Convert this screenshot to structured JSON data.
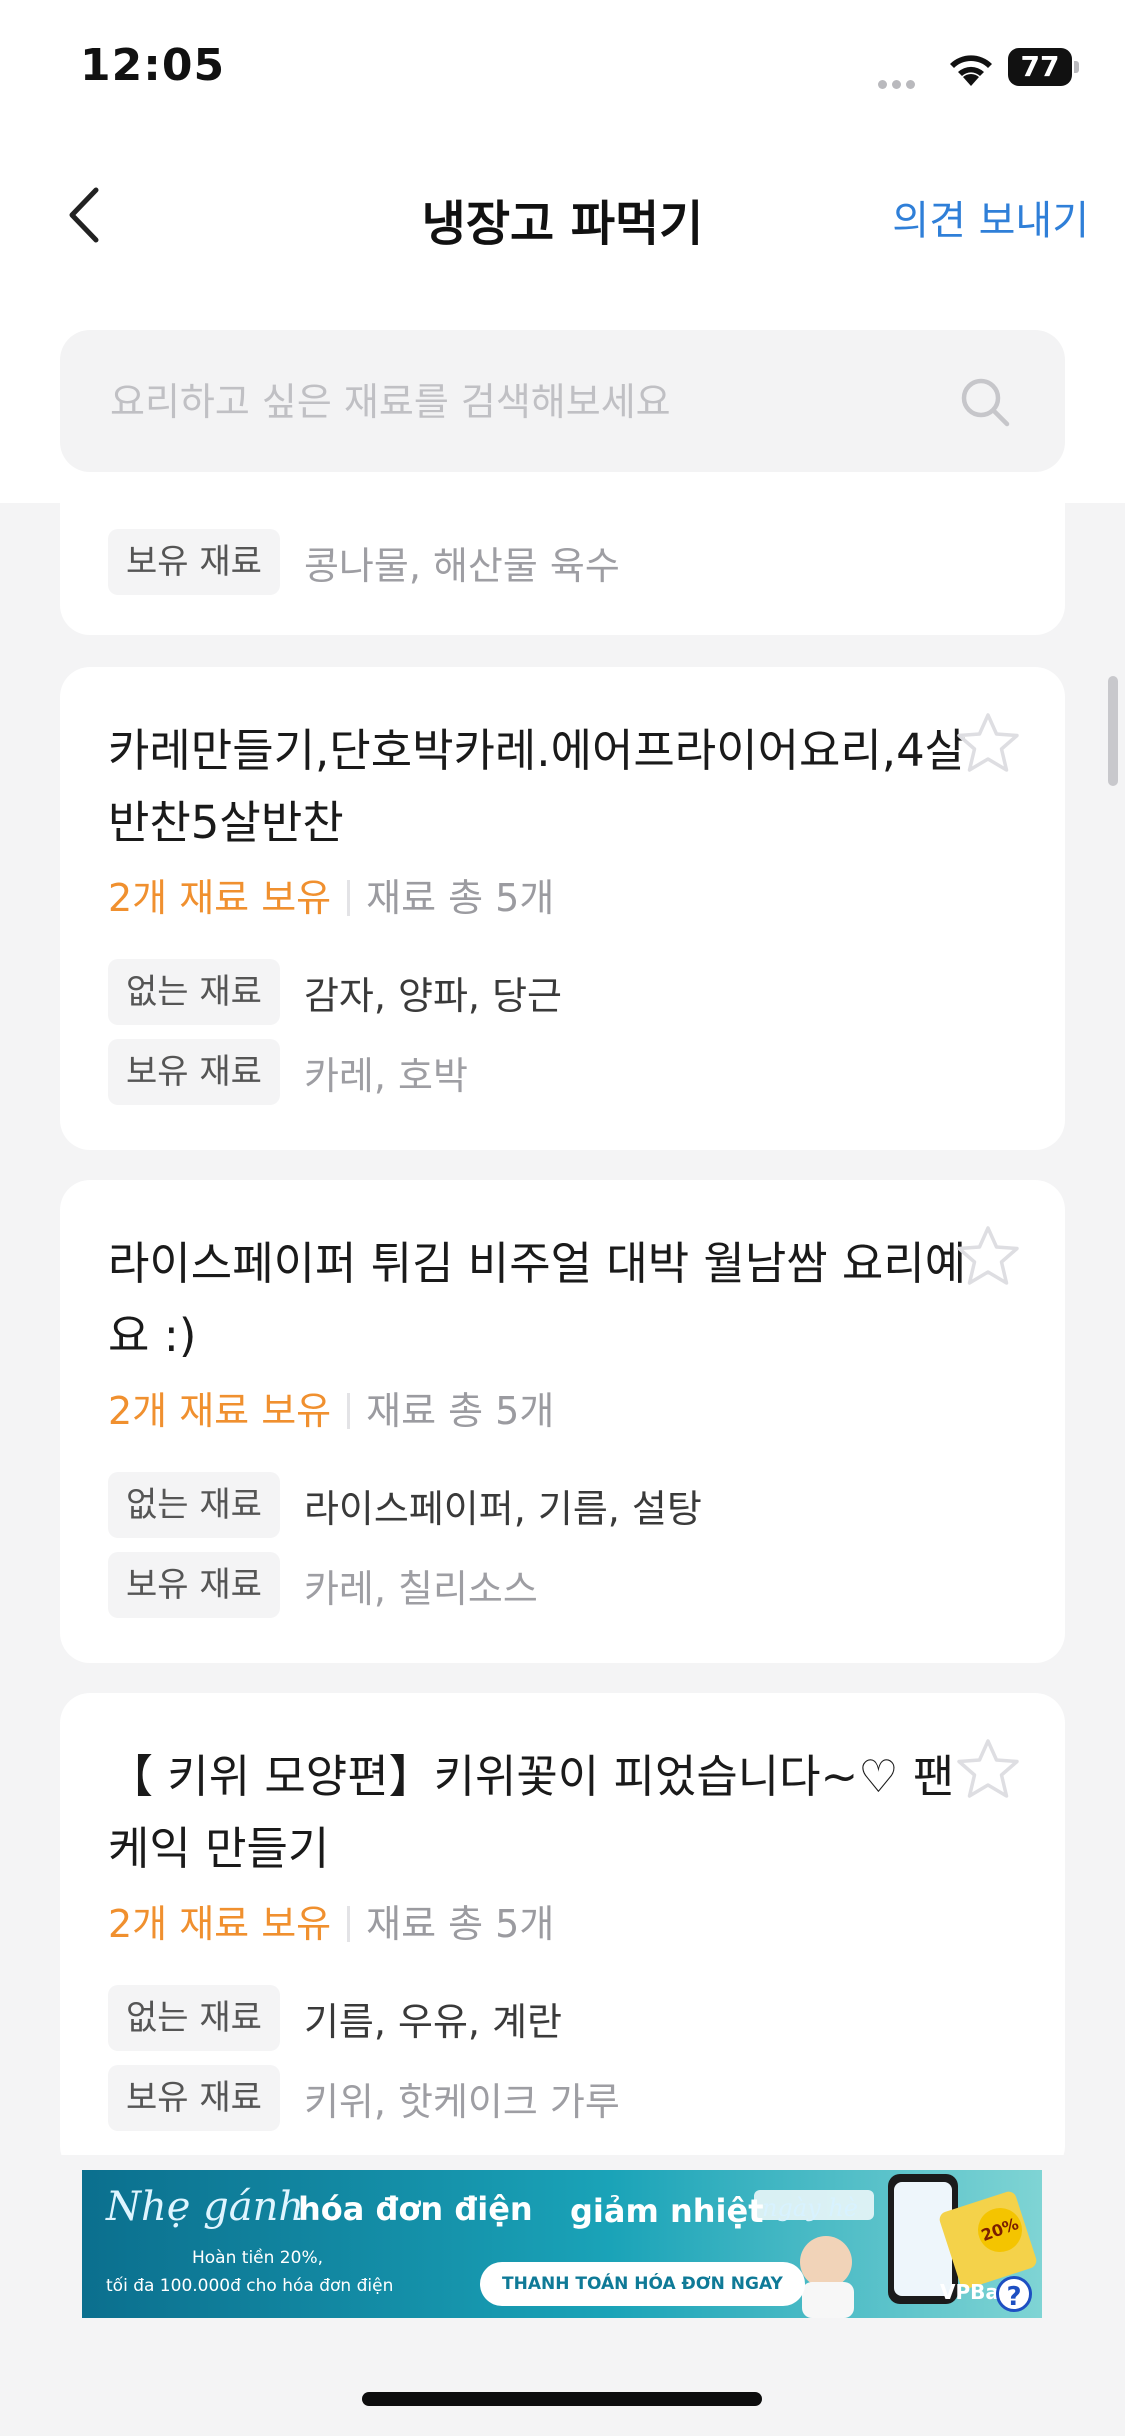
{
  "status_bar": {
    "time": "12:05",
    "battery": "77"
  },
  "nav": {
    "title": "냉장고 파먹기",
    "feedback_label": "의견 보내기"
  },
  "search": {
    "placeholder": "요리하고 싶은 재료를 검색해보세요",
    "value": ""
  },
  "labels": {
    "missing": "없는 재료",
    "owned": "보유 재료"
  },
  "recipes": [
    {
      "title": "",
      "owned_ingredients": "콩나물, 해산물 육수"
    },
    {
      "title": "카레만들기,단호박카레.에어프라이어요리,4살반찬5살반찬",
      "own_count": "2개 재료 보유",
      "total_count": "재료 총 5개",
      "missing_ingredients": "감자, 양파, 당근",
      "owned_ingredients": "카레, 호박"
    },
    {
      "title": "라이스페이퍼 튀김 비주얼 대박 월남쌈 요리예요 :)",
      "own_count": "2개 재료 보유",
      "total_count": "재료 총 5개",
      "missing_ingredients": "라이스페이퍼, 기름, 설탕",
      "owned_ingredients": "카레, 칠리소스"
    },
    {
      "title": "【 키위 모양편】키위꽃이 피었습니다~♡ 팬케익 만들기",
      "own_count": "2개 재료 보유",
      "total_count": "재료 총 5개",
      "missing_ingredients": "기름, 우유, 계란",
      "owned_ingredients": "키위, 핫케이크 가루"
    }
  ],
  "ad": {
    "script_text": "Nhẹ gánh",
    "headline": "hóa đơn điện",
    "headline2": "giảm nhiệt",
    "script_text2": "ngày hè",
    "sub1": "Hoàn tiền 20%,",
    "sub2": "tối đa 100.000đ cho hóa đơn điện",
    "cta": "THANH TOÁN HÓA ĐƠN NGAY",
    "badge": "20%",
    "brand": "VPBa",
    "help": "?"
  },
  "colors": {
    "accent_blue": "#2f7fd8",
    "accent_orange": "#f0902f",
    "background": "#f4f4f5"
  }
}
